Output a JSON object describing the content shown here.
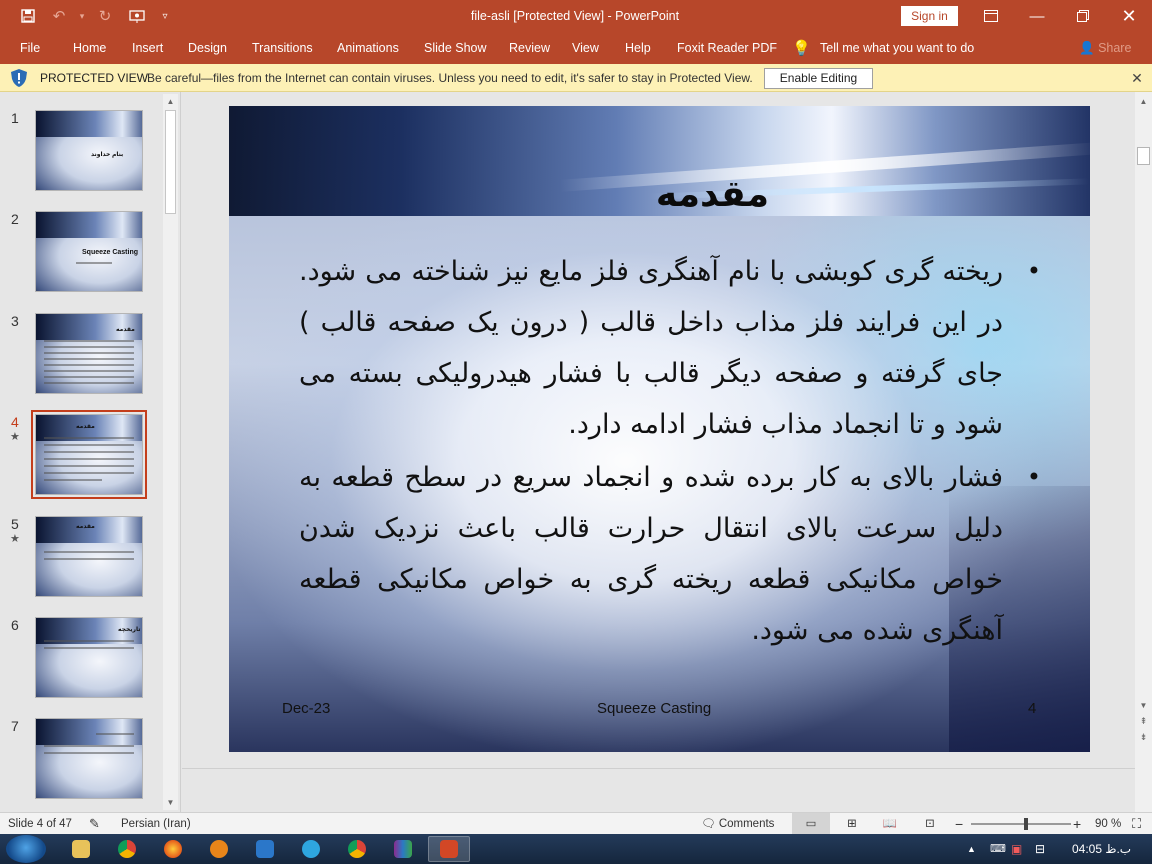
{
  "window": {
    "title": "file-asli [Protected View]  -  PowerPoint",
    "sign_in": "Sign in"
  },
  "ribbon": {
    "tabs": [
      "File",
      "Home",
      "Insert",
      "Design",
      "Transitions",
      "Animations",
      "Slide Show",
      "Review",
      "View",
      "Help",
      "Foxit Reader PDF"
    ],
    "tell_me": "Tell me what you want to do",
    "share": "Share"
  },
  "protected_view": {
    "title": "PROTECTED VIEW",
    "message": "Be careful—files from the Internet can contain viruses. Unless you need to edit, it's safer to stay in Protected View.",
    "enable_button": "Enable Editing"
  },
  "thumbnails": [
    {
      "num": "1",
      "star": false,
      "text": "بنام خداوند",
      "selected": false
    },
    {
      "num": "2",
      "star": false,
      "text": "Squeeze Casting",
      "selected": false
    },
    {
      "num": "3",
      "star": false,
      "text": "مقدمه",
      "selected": false
    },
    {
      "num": "4",
      "star": true,
      "text": "مقدمه",
      "selected": true
    },
    {
      "num": "5",
      "star": true,
      "text": "مقدمه",
      "selected": false
    },
    {
      "num": "6",
      "star": false,
      "text": "تاریخچه",
      "selected": false
    },
    {
      "num": "7",
      "star": false,
      "text": "",
      "selected": false
    }
  ],
  "slide": {
    "title": "مقدمه",
    "bullets": [
      "ریخته گری کوبشی با نام آهنگری فلز مایع نیز شناخته می شود. در این فرایند فلز مذاب داخل قالب ( درون یک صفحه قالب ) جای گرفته و صفحه دیگر قالب با فشار هیدرولیکی بسته می شود و تا انجماد مذاب فشار ادامه دارد.",
      "فشار بالای به کار برده شده و انجماد سریع در سطح قطعه به دلیل سرعت بالای انتقال حرارت قالب باعث نزدیک شدن خواص مکانیکی قطعه ریخته گری به خواص مکانیکی قطعه آهنگری شده می شود."
    ],
    "footer_date": "Dec-23",
    "footer_center": "Squeeze Casting",
    "footer_num": "4"
  },
  "status": {
    "slide_count": "Slide 4 of 47",
    "language": "Persian (Iran)",
    "comments": "Comments",
    "zoom": "90 %",
    "zoom_fraction": 0.55
  },
  "taskbar": {
    "clock": "04:05 ب.ظ"
  }
}
